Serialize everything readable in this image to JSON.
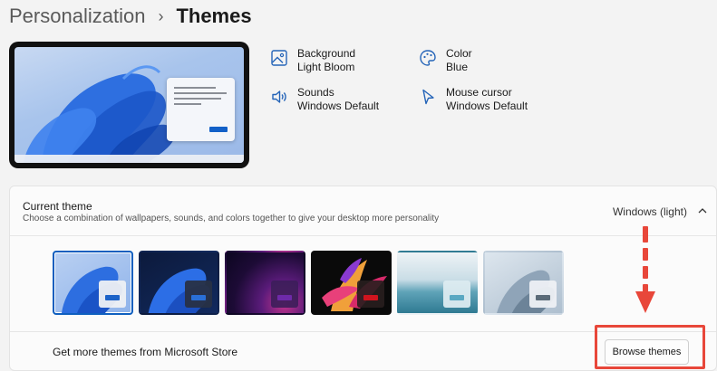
{
  "breadcrumb": {
    "parent": "Personalization",
    "separator": "›",
    "current": "Themes"
  },
  "theme_properties": [
    {
      "name": "Background",
      "value": "Light Bloom",
      "icon": "image-icon"
    },
    {
      "name": "Color",
      "value": "Blue",
      "icon": "palette-icon"
    },
    {
      "name": "Sounds",
      "value": "Windows Default",
      "icon": "speaker-icon"
    },
    {
      "name": "Mouse cursor",
      "value": "Windows Default",
      "icon": "cursor-icon"
    }
  ],
  "current_theme": {
    "title": "Current theme",
    "description": "Choose a combination of wallpapers, sounds, and colors together to give your desktop more personality",
    "value": "Windows (light)",
    "expanded": true
  },
  "themes": [
    {
      "id": "windows-light",
      "selected": true,
      "accent": "#1d63c8"
    },
    {
      "id": "windows-dark",
      "selected": false,
      "accent": "#2a6fd6"
    },
    {
      "id": "glow",
      "selected": false,
      "accent": "#6e2aa8"
    },
    {
      "id": "captured-motion",
      "selected": false,
      "accent": "#d0141e"
    },
    {
      "id": "sunrise",
      "selected": false,
      "accent": "#5aa8c2"
    },
    {
      "id": "flow",
      "selected": false,
      "accent": "#5b6b78"
    }
  ],
  "store": {
    "text": "Get more themes from Microsoft Store",
    "button": "Browse themes"
  },
  "annotation_color": "#e8473a"
}
